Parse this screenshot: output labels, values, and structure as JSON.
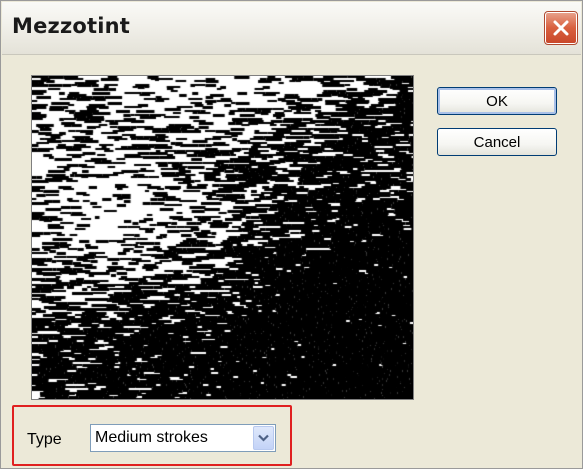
{
  "window": {
    "title": "Mezzotint"
  },
  "buttons": {
    "ok_label": "OK",
    "cancel_label": "Cancel"
  },
  "type_control": {
    "label": "Type",
    "selected_value": "Medium strokes"
  },
  "icons": {
    "close": "close-icon",
    "dropdown": "chevron-down-icon"
  },
  "colors": {
    "dialog_bg": "#ece9d8",
    "close_button": "#d9603f",
    "highlight_border": "#e02020",
    "preview_ink": "#000000"
  }
}
